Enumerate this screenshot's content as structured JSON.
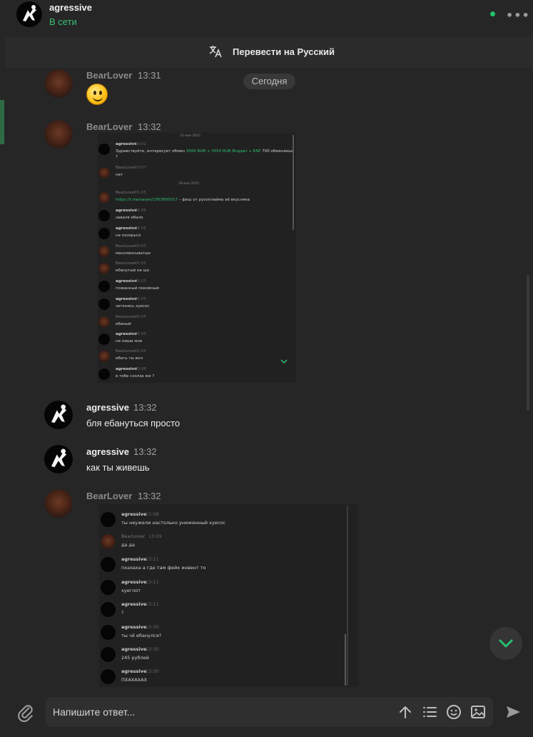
{
  "header": {
    "contact_name": "agressive",
    "status": "В сети"
  },
  "translate_bar": {
    "label": "Перевести на Русский"
  },
  "date_badge": "Сегодня",
  "messages": [
    {
      "sender": "BearLover",
      "time": "13:31",
      "content": "emoji"
    },
    {
      "sender": "BearLover",
      "time": "13:32",
      "content": "screenshot"
    },
    {
      "sender": "agressive",
      "time": "13:32",
      "text": "бля ебануться просто"
    },
    {
      "sender": "agressive",
      "time": "13:32",
      "text": "как ты живешь"
    },
    {
      "sender": "BearLover",
      "time": "13:32",
      "content": "screenshot"
    }
  ],
  "screenshot1": {
    "dates": [
      "13 мая 2025",
      "29 мая 2025"
    ],
    "rows": [
      {
        "sender": "agressive",
        "time": "10:01",
        "text_a": "Здравствуйте, интересует обмен ",
        "link": "3500 RUB + 3550 RUB Blupper + ЕАЕ",
        "text_b": " 700 обменяешь",
        "text_c": "?"
      },
      {
        "sender": "BearLover",
        "time": "10:07",
        "text_a": "нет"
      },
      {
        "sender": "BearLover",
        "time": "05:05",
        "link": "https://t.me/sasen/1563800017",
        "text_b": " – фиш от русоплайма аё вкусняка"
      },
      {
        "sender": "agressive",
        "time": "05:05",
        "text_a": "заваля ебало"
      },
      {
        "sender": "agressive",
        "time": "05:05",
        "text_a": "не позорься"
      },
      {
        "sender": "BearLover",
        "time": "05:05",
        "text_a": "масолвосыватые"
      },
      {
        "sender": "BearLover",
        "time": "05:05",
        "text_a": "ебанутый не шо"
      },
      {
        "sender": "agressive",
        "time": "05:05",
        "text_a": "пожанный покойный"
      },
      {
        "sender": "agressive",
        "time": "05:05",
        "text_a": "заткнись хуесос"
      },
      {
        "sender": "BearLover",
        "time": "05:05",
        "text_a": "ебаный"
      },
      {
        "sender": "agressive",
        "time": "05:05",
        "text_a": "не пиши мне"
      },
      {
        "sender": "BearLover",
        "time": "05:05",
        "text_a": "ебать ты внн"
      },
      {
        "sender": "agressive",
        "time": "05:06",
        "text_a": "в тебе схолза же ?"
      }
    ]
  },
  "screenshot2": {
    "rows": [
      {
        "sender": "agressive",
        "time": "13:08",
        "text": "ты неужели настолько униженный хуесос"
      },
      {
        "sender": "BearLover",
        "time": "13:09",
        "text": "да да"
      },
      {
        "sender": "agressive",
        "time": "13:11",
        "text": "пхахаха а где там фейк инвент то"
      },
      {
        "sender": "agressive",
        "time": "13:11",
        "text": "хуеглот"
      },
      {
        "sender": "agressive",
        "time": "13:11",
        "text": "?"
      },
      {
        "sender": "agressive",
        "time": "13:30",
        "text": "ты чё ебанулся?"
      },
      {
        "sender": "agressive",
        "time": "13:30",
        "text": "245 рублей"
      },
      {
        "sender": "agressive",
        "time": "13:30",
        "text": "ПХАХАХАХ"
      }
    ]
  },
  "composer": {
    "placeholder": "Напишите ответ..."
  },
  "icons": {
    "attach": "paperclip-icon",
    "upload": "arrow-up-icon",
    "list": "list-icon",
    "emoji": "smile-icon",
    "image": "image-icon",
    "send": "send-icon",
    "translate": "translate-icon",
    "scroll": "chevron-down-icon",
    "menu": "more-dots-icon"
  },
  "colors": {
    "background": "#262626",
    "online": "#21c26b",
    "accent": "#2e6b45"
  }
}
